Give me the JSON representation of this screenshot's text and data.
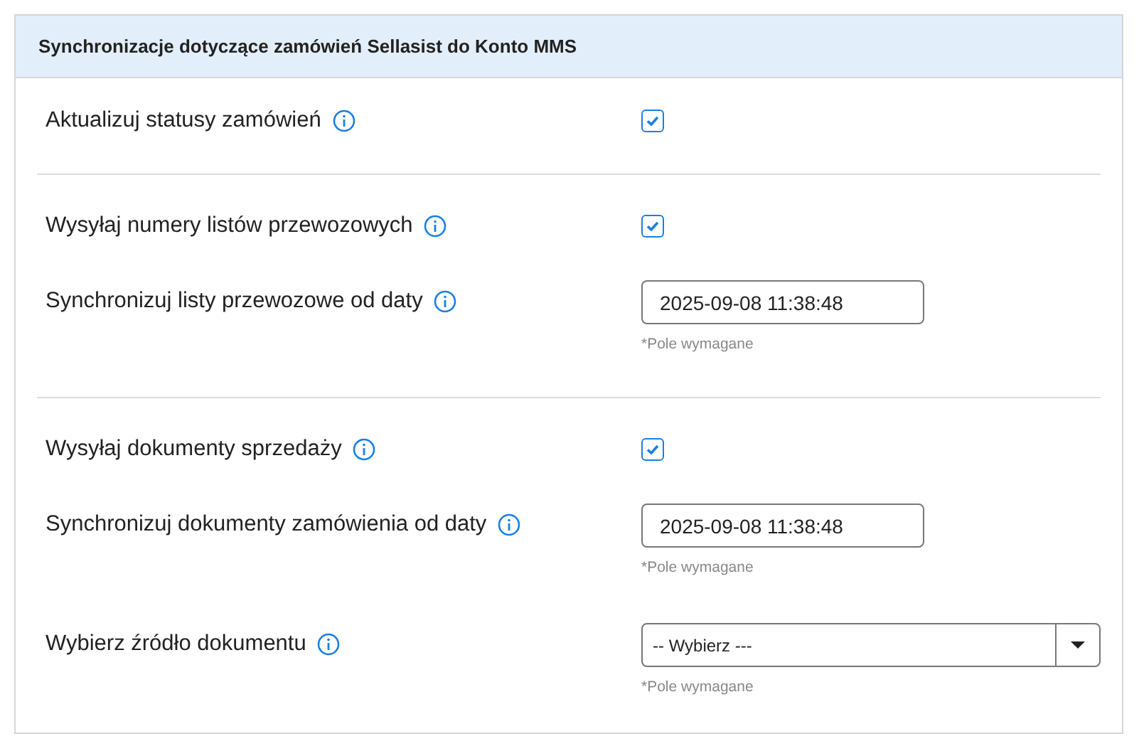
{
  "panel": {
    "title": "Synchronizacje dotyczące zamówień Sellasist do Konto MMS"
  },
  "sections": [
    {
      "rows": [
        {
          "kind": "checkbox",
          "label": "Aktualizuj statusy zamówień",
          "checked": true
        }
      ]
    },
    {
      "rows": [
        {
          "kind": "checkbox",
          "label": "Wysyłaj numery listów przewozowych",
          "checked": true
        },
        {
          "kind": "date",
          "label": "Synchronizuj listy przewozowe od daty",
          "value": "2025-09-08 11:38:48",
          "hint": "*Pole wymagane"
        }
      ]
    },
    {
      "rows": [
        {
          "kind": "checkbox",
          "label": "Wysyłaj dokumenty sprzedaży",
          "checked": true
        },
        {
          "kind": "date",
          "label": "Synchronizuj dokumenty zamówienia od daty",
          "value": "2025-09-08 11:38:48",
          "hint": "*Pole wymagane"
        },
        {
          "kind": "select",
          "label": "Wybierz źródło dokumentu",
          "value": "-- Wybierz ---",
          "hint": "*Pole wymagane"
        }
      ]
    }
  ]
}
